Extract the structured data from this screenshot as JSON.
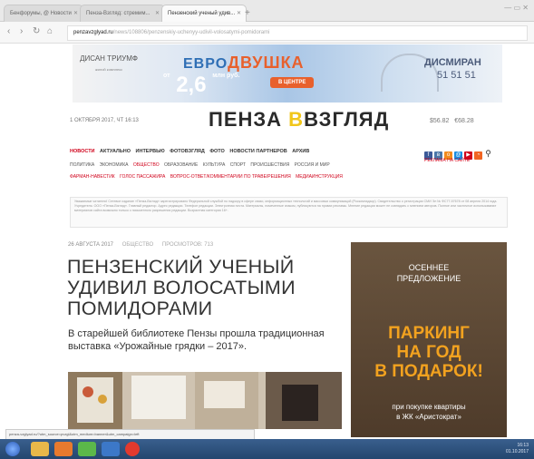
{
  "browser": {
    "tabs": [
      {
        "label": "Бенфорумы, @ Новости"
      },
      {
        "label": "Пенза-Взгляд: стремим..."
      },
      {
        "label": "Пензенский ученый удив..."
      }
    ],
    "new_tab": "+",
    "window_controls": "— ▭ ✕",
    "url_domain": "penzavzglyad.ru",
    "url_rest": "/news/108806/penzenskiy-uchenyy-udivil-volosatymi-pomidorami"
  },
  "banner": {
    "left_brand": "ДИСАН ТРИУМФ",
    "left_sub": "жилой комплекс",
    "headline_a": "ЕВРО",
    "headline_b": "ДВУШКА",
    "price_from": "от",
    "price": "2,6",
    "price_unit": "млн руб.",
    "badge": "В ЦЕНТРЕ",
    "right_brand": "ДИСМИРАН",
    "right_phone": "51 51 51"
  },
  "site": {
    "date": "1 ОКТЯБРЯ 2017, ЧТ 16:13",
    "logo_a": "ПЕНЗА",
    "logo_b": "В",
    "logo_c": "ВЗГЛЯД",
    "usd": "$56.82",
    "eur": "€68.28",
    "menu_main": [
      "НОВОСТИ",
      "АКТУАЛЬНО",
      "ИНТЕРВЬЮ",
      "ФОТОВЗГЛЯД",
      "ФОТО",
      "НОВОСТИ ПАРТНЕРОВ",
      "АРХИВ"
    ],
    "menu_sub": [
      "ПОЛИТИКА",
      "ЭКОНОМИКА",
      "ОБЩЕСТВО",
      "ОБРАЗОВАНИЕ",
      "КУЛЬТУРА",
      "СПОРТ",
      "ПРОИСШЕСТВИЯ",
      "РОССИЯ И МИР"
    ],
    "menu_special": [
      "ФАРМАН-НАВЕСТИК",
      "ГОЛОС ПАССАЖИРА",
      "ВОПРОС-ОТВЕТ/КОММЕНТАРИИ ПО ТРАВЕ/РЕШЕНИЯ",
      "МЕДИАИНСТРУКЦИЯ"
    ],
    "ads_link": "РЕКЛАМА НА САЙТЕ",
    "notice": "Уважаемые читатели! Сетевое издание «Пенза-Взгляд» зарегистрировано Федеральной службой по надзору в сфере связи, информационных технологий и массовых коммуникаций (Роскомнадзор). Свидетельство о регистрации СМИ Эл № ФС77-57678 от 08 апреля 2014 года. Учредитель: ООО «Пенза-Взгляд». Главный редактор. Адрес редакции. Телефон редакции. Электронная почта. Материалы, помеченные знаком, публикуются на правах рекламы. Мнение редакции может не совпадать с мнением авторов. Полное или частичное использование материалов сайта возможно только с письменного разрешения редакции. Возрастная категория 16+."
  },
  "article": {
    "date": "26 АВГУСТА 2017",
    "category": "ОБЩЕСТВО",
    "extra": "ПРОСМОТРОВ: 713",
    "headline_lines": [
      "ПЕНЗЕНСКИЙ УЧЕНЫЙ",
      "УДИВИЛ ВОЛОСАТЫМИ",
      "ПОМИДОРАМИ"
    ],
    "lead": "В старейшей библиотеке Пензы прошла традиционная выставка «Урожайные грядки – 2017»."
  },
  "side_ad": {
    "line1": "ОСЕННЕЕ",
    "line2": "ПРЕДЛОЖЕНИЕ",
    "big1": "ПАРКИНГ",
    "big2": "НА ГОД",
    "big3": "В ПОДАРОК!",
    "small1": "при покупке квартиры",
    "small2": "в ЖК «Аристократ»"
  },
  "status_url": "penza-vzglyad.ru/?utm_source=pvzgl&utm_medium=banner&utm_campaign=left",
  "taskbar": {
    "tray_time": "16:13",
    "tray_date": "01.10.2017"
  },
  "colors": {
    "accent_red": "#d0021b",
    "logo_yellow": "#f1c61a",
    "ad_orange": "#f2a21f"
  }
}
